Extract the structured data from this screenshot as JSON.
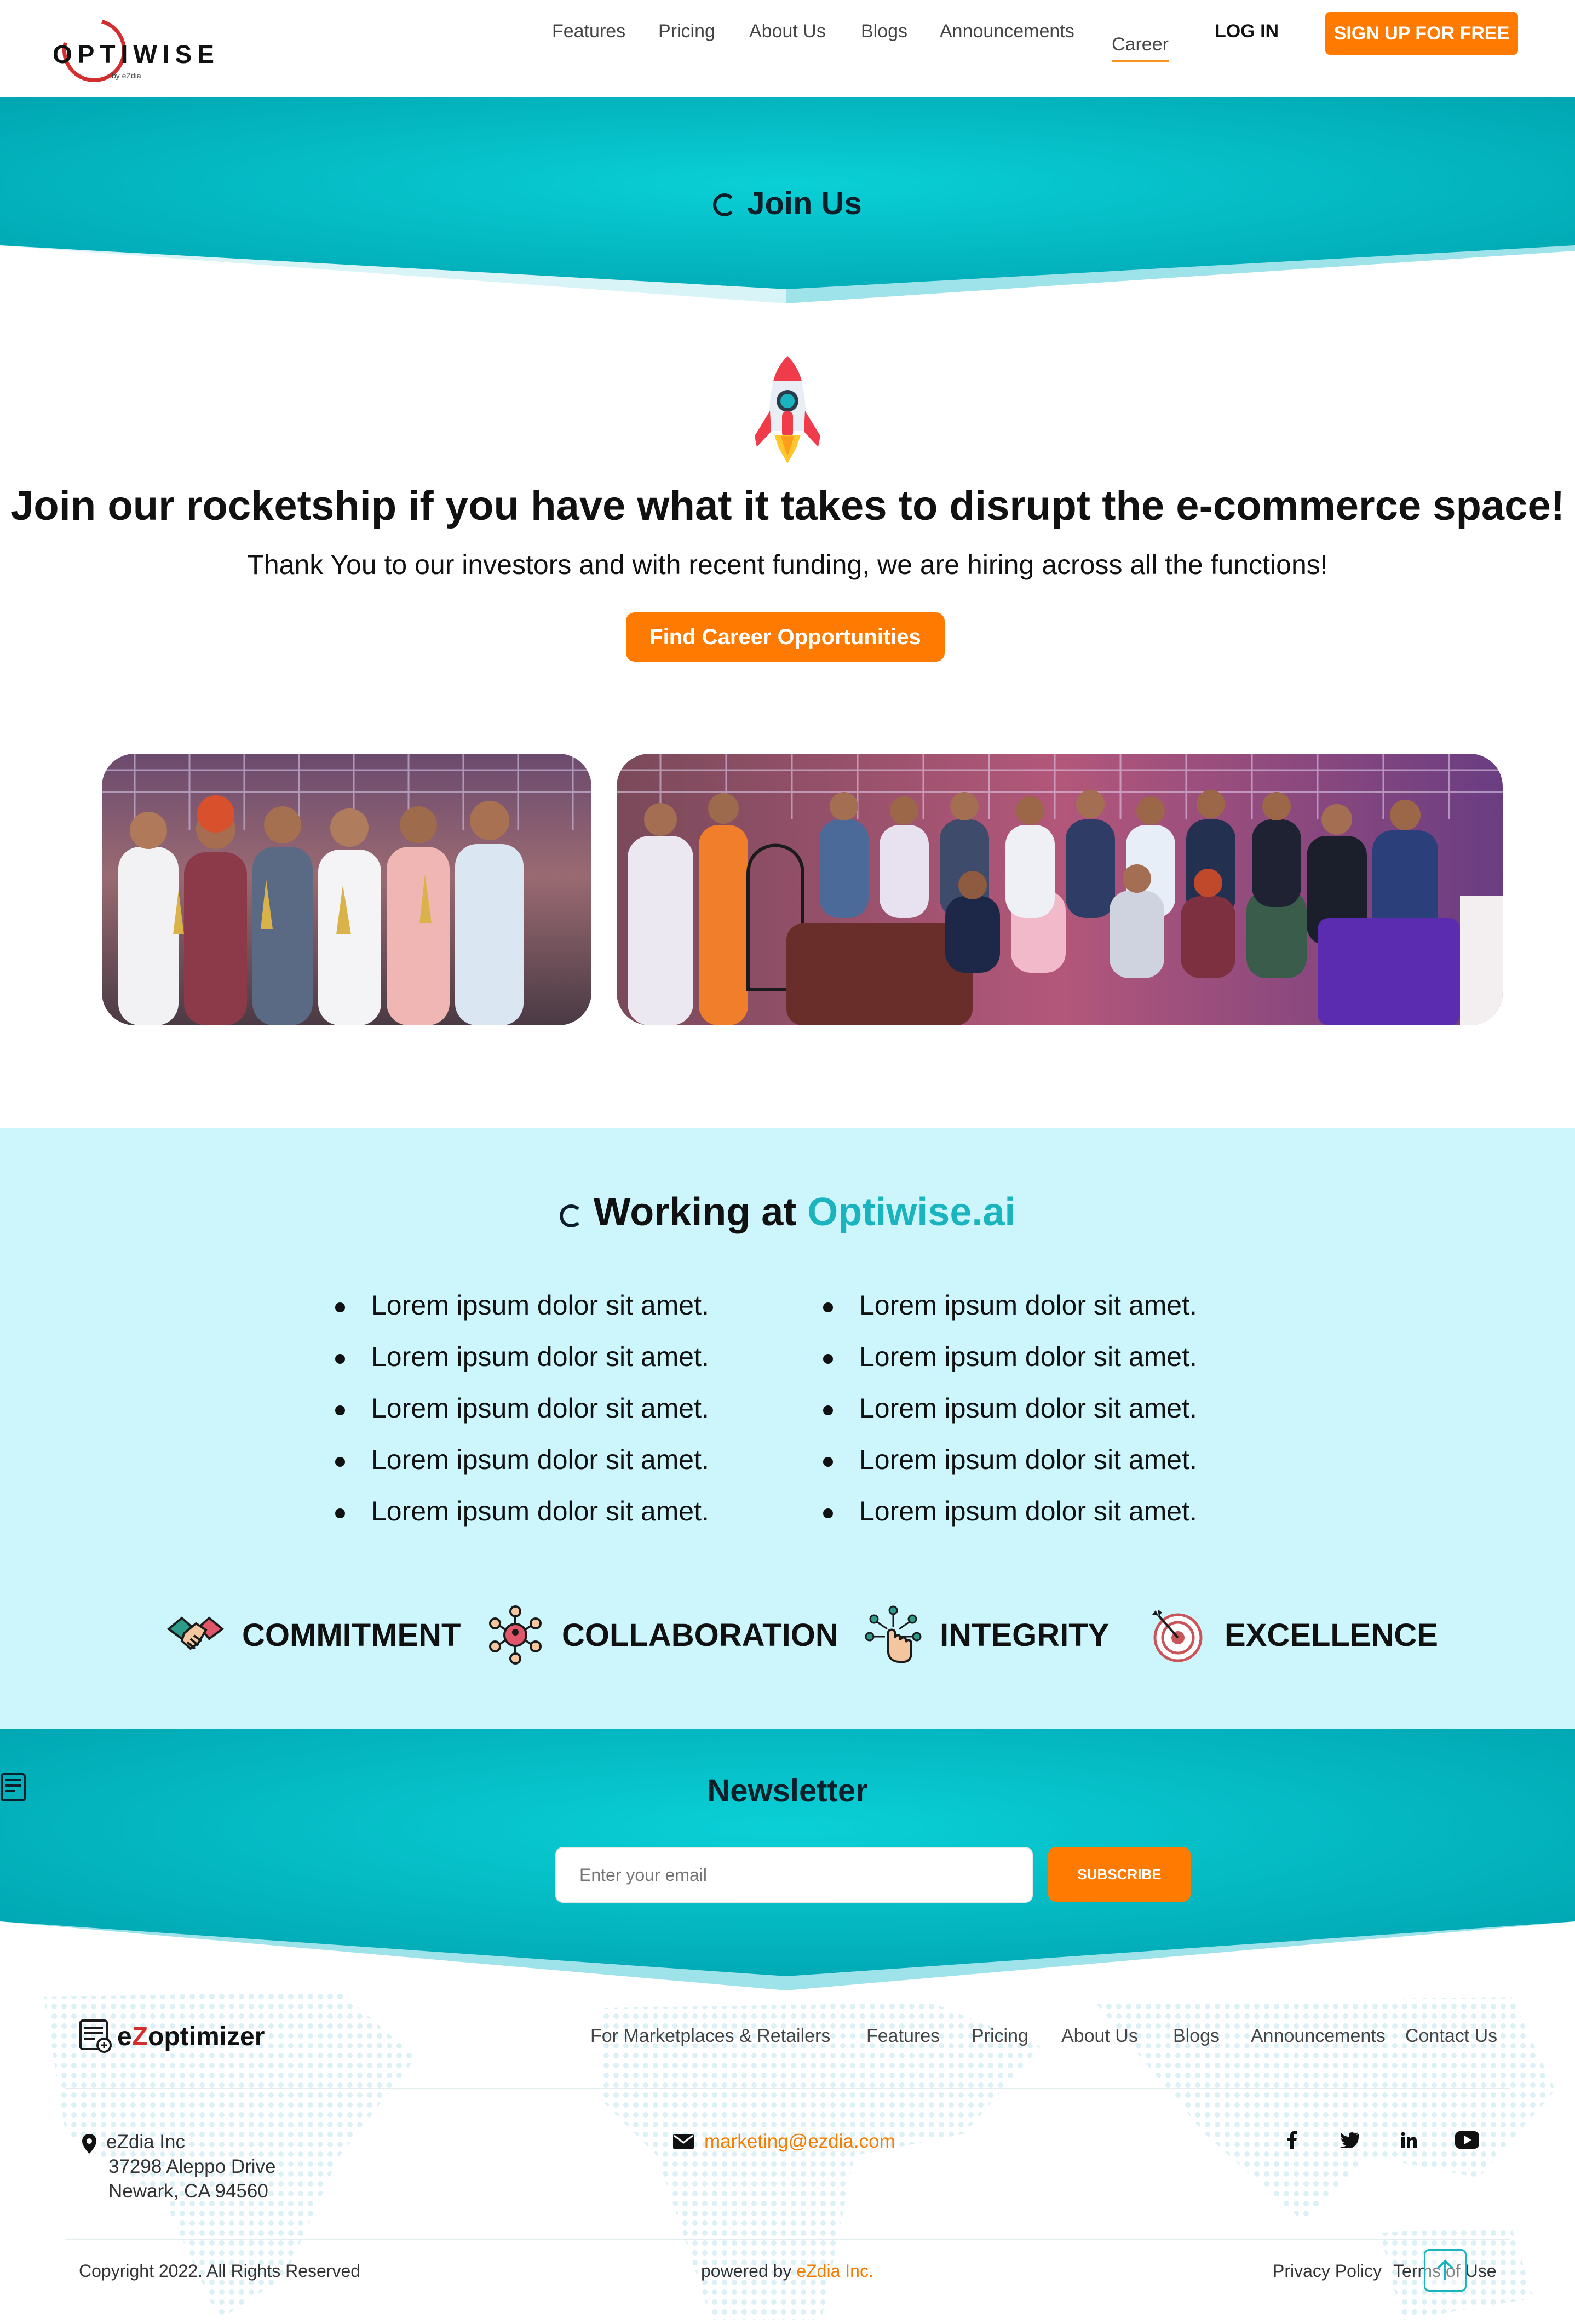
{
  "header": {
    "logo_text": "OPTIWISE",
    "logo_sub": "by eZdia",
    "nav": [
      "Features",
      "Pricing",
      "About Us",
      "Blogs",
      "Announcements",
      "Career"
    ],
    "login_label": "LOG IN",
    "signup_label": "SIGN UP FOR FREE"
  },
  "banner": {
    "title": "Join Us"
  },
  "hero": {
    "heading": "Join our rocketship if you have what it takes to disrupt the e-commerce space!",
    "subheading": "Thank You to our investors and with recent funding, we are hiring across all the functions!",
    "cta_label": "Find Career Opportunities"
  },
  "working": {
    "title_prefix": "Working at",
    "title_brand": "Optiwise.ai",
    "bullets_left": [
      "Lorem ipsum dolor sit amet.",
      "Lorem ipsum dolor sit amet.",
      "Lorem ipsum dolor sit amet.",
      "Lorem ipsum dolor sit amet.",
      "Lorem ipsum dolor sit amet."
    ],
    "bullets_right": [
      "Lorem ipsum dolor sit amet.",
      "Lorem ipsum dolor sit amet.",
      "Lorem ipsum dolor sit amet.",
      "Lorem ipsum dolor sit amet.",
      "Lorem ipsum dolor sit amet."
    ],
    "values": [
      {
        "label": "COMMITMENT",
        "icon": "handshake-icon"
      },
      {
        "label": "COLLABORATION",
        "icon": "network-icon"
      },
      {
        "label": "INTEGRITY",
        "icon": "touch-network-icon"
      },
      {
        "label": "EXCELLENCE",
        "icon": "target-icon"
      }
    ]
  },
  "newsletter": {
    "title": "Newsletter",
    "placeholder": "Enter your email",
    "subscribe_label": "SUBSCRIBE"
  },
  "footer": {
    "brand_prefix": "e",
    "brand_z": "Z",
    "brand_suffix": "optimizer",
    "nav": [
      "For Marketplaces & Retailers",
      "Features",
      "Pricing",
      "About Us",
      "Blogs",
      "Announcements",
      "Contact Us"
    ],
    "address": [
      "eZdia Inc",
      "37298 Aleppo Drive",
      "Newark, CA 94560"
    ],
    "email": "marketing@ezdia.com",
    "social": [
      "facebook-icon",
      "twitter-icon",
      "linkedin-icon",
      "youtube-icon"
    ],
    "copyright": "Copyright 2022. All Rights Reserved",
    "powered_prefix": "powered by",
    "powered_link": "eZdia Inc.",
    "privacy": "Privacy Policy",
    "terms": "Terms of Use"
  },
  "colors": {
    "teal": "#1ab4be",
    "orange": "#ff7a00",
    "light_cyan": "#ccf6fc",
    "red": "#d32f2f"
  }
}
